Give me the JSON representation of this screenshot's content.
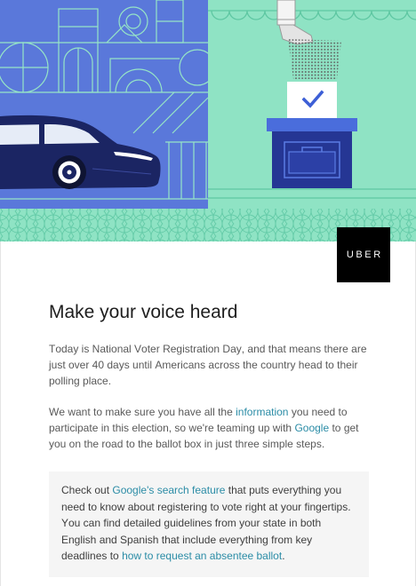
{
  "brand": {
    "logo_text": "UBER"
  },
  "heading": "Make your voice heard",
  "intro": "Today is National Voter Registration Day, and that means there are just over 40 days until Americans across the country head to their polling place.",
  "partnership": {
    "text_before": "We want to make sure you have all the ",
    "information_link": "information",
    "text_middle": " you need to participate in this election, so we're teaming up with ",
    "google_link": "Google",
    "text_after": " to get you on the road to the ballot box in just three simple steps."
  },
  "callout": {
    "text_before": "Check out ",
    "search_feature_link": "Google's search feature",
    "text_middle": " that puts everything you need to know about registering to vote right at your fingertips. You can find detailed guidelines from your state in both English and Spanish that include everything from key deadlines to ",
    "absentee_ballot_link": "how to request an absentee ballot",
    "text_after": "."
  },
  "colors": {
    "hero_blue": "#5a78da",
    "hero_mint": "#8fe3c4",
    "car_navy": "#1b2563",
    "ballot_box_navy": "#253694",
    "ballot_lid_blue": "#4a6ddc",
    "link": "#2b8ca6",
    "logo_background": "#000000",
    "callout_background": "#f5f5f5"
  }
}
